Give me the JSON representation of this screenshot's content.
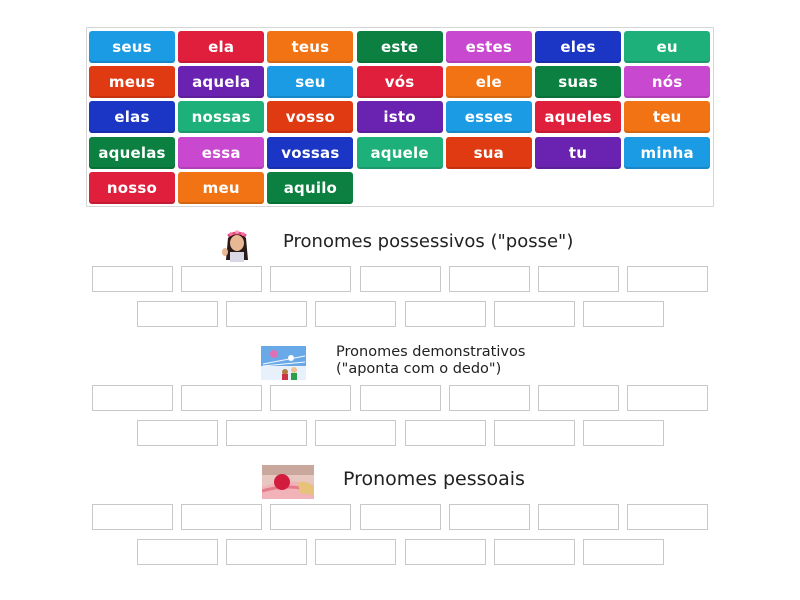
{
  "tiles": [
    {
      "label": "seus",
      "color": "#1a9be3"
    },
    {
      "label": "ela",
      "color": "#e01f3d"
    },
    {
      "label": "teus",
      "color": "#f27314"
    },
    {
      "label": "este",
      "color": "#0b8040"
    },
    {
      "label": "estes",
      "color": "#c848cf"
    },
    {
      "label": "eles",
      "color": "#1b36c4"
    },
    {
      "label": "eu",
      "color": "#1eb07a"
    },
    {
      "label": "meus",
      "color": "#e03a12"
    },
    {
      "label": "aquela",
      "color": "#6a23b0"
    },
    {
      "label": "seu",
      "color": "#1a9be3"
    },
    {
      "label": "vós",
      "color": "#e01f3d"
    },
    {
      "label": "ele",
      "color": "#f27314"
    },
    {
      "label": "suas",
      "color": "#0b8040"
    },
    {
      "label": "nós",
      "color": "#c848cf"
    },
    {
      "label": "elas",
      "color": "#1b36c4"
    },
    {
      "label": "nossas",
      "color": "#1eb07a"
    },
    {
      "label": "vosso",
      "color": "#e03a12"
    },
    {
      "label": "isto",
      "color": "#6a23b0"
    },
    {
      "label": "esses",
      "color": "#1a9be3"
    },
    {
      "label": "aqueles",
      "color": "#e01f3d"
    },
    {
      "label": "teu",
      "color": "#f27314"
    },
    {
      "label": "aquelas",
      "color": "#0b8040"
    },
    {
      "label": "essa",
      "color": "#c848cf"
    },
    {
      "label": "vossas",
      "color": "#1b36c4"
    },
    {
      "label": "aquele",
      "color": "#1eb07a"
    },
    {
      "label": "sua",
      "color": "#e03a12"
    },
    {
      "label": "tu",
      "color": "#6a23b0"
    },
    {
      "label": "minha",
      "color": "#1a9be3"
    },
    {
      "label": "nosso",
      "color": "#e01f3d"
    },
    {
      "label": "meu",
      "color": "#f27314"
    },
    {
      "label": "aquilo",
      "color": "#0b8040"
    }
  ],
  "sections": [
    {
      "title": "Pronomes possessivos (\"posse\")",
      "image": "girl-avatar-image",
      "drop_rows": [
        7,
        6
      ]
    },
    {
      "title_line1": "Pronomes demonstrativos",
      "title_line2": "(\"aponta com o dedo\")",
      "image": "kids-pointing-image",
      "drop_rows": [
        7,
        6
      ]
    },
    {
      "title": "Pronomes pessoais",
      "image": "hands-holding-ball-image",
      "drop_rows": [
        7,
        6
      ]
    }
  ]
}
